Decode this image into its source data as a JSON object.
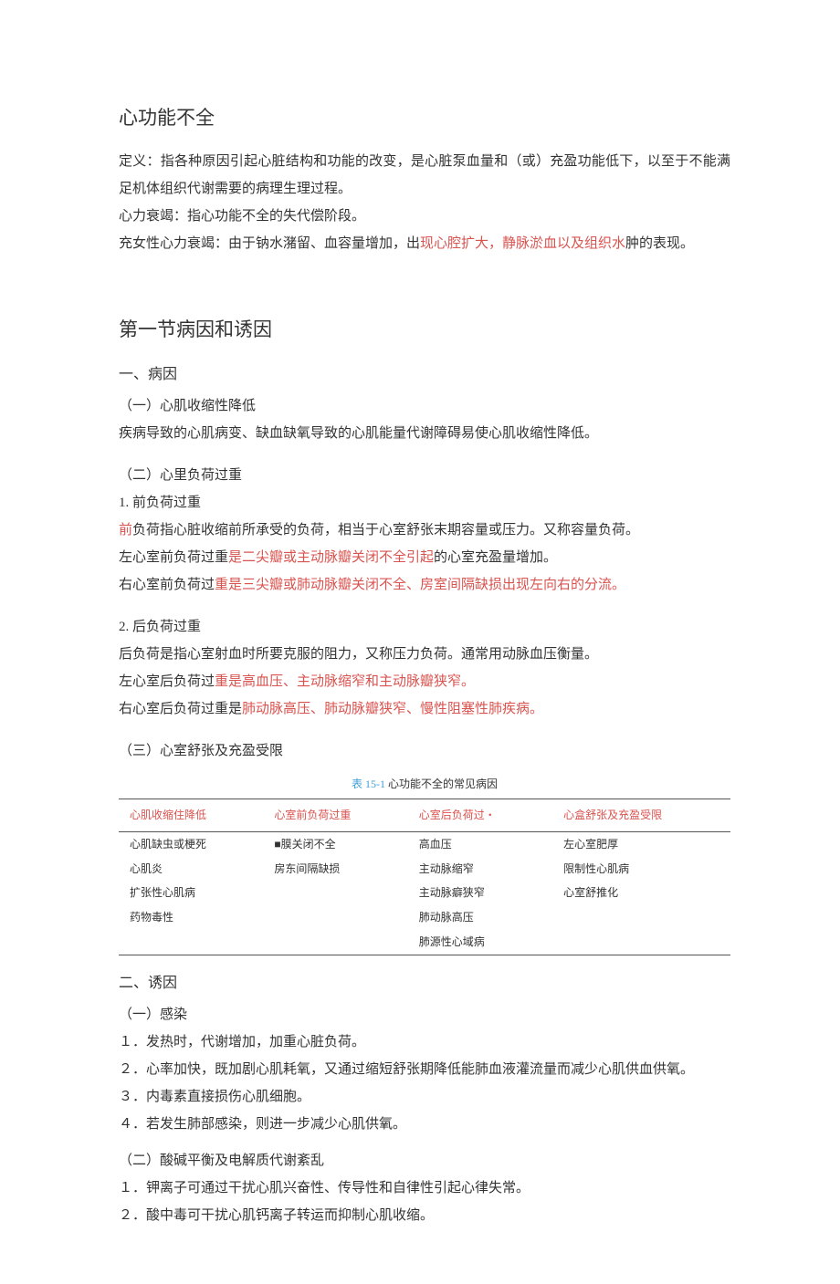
{
  "title": "心功能不全",
  "definition": {
    "label": "定义：",
    "body_a": "指各种原因引起心脏结构和功能的改变，是心脏泵血量和（或）充盈功能低下，以至于不能满足机体组织代谢需要的病理生理过程。"
  },
  "line_heart_failure": "心力衰竭：指心功能不全的失代偿阶段。",
  "congestive": {
    "pre": "充女性心力衰竭：由于钠水潴留、血容量增加，出",
    "red": "现心腔扩大，静脉淤血以及组织水",
    "post": "肿的表现。"
  },
  "sec1": {
    "heading": "第一节病因和诱因",
    "sub1": "一、病因",
    "item1_title": "（一）心肌收缩性降低",
    "item1_body": "疾病导致的心肌病变、缺血缺氧导致的心肌能量代谢障碍易使心肌收缩性降低。",
    "item2_title": "（二）心里负荷过重",
    "preload_label": "1. 前负荷过重",
    "preload_l1_pre": "前",
    "preload_l1_post": "负荷指心脏收缩前所承受的负荷，相当于心室舒张末期容量或压力。又称容量负荷。",
    "preload_l2_pre": "左心室前负荷过重",
    "preload_l2_red": "是二尖瓣或主动脉瓣关闭不全引起",
    "preload_l2_post": "的心室充盈量增加。",
    "preload_l3_pre": "右心室前负荷过",
    "preload_l3_red": "重是三尖瓣或肺动脉瓣关闭不全、房室间隔缺损出现左向右的分流。",
    "afterload_label": "2. 后负荷过重",
    "afterload_l1": "后负荷是指心室射血时所要克服的阻力，又称压力负荷。通常用动脉血压衡量。",
    "afterload_l2_pre": "左心室后负荷过",
    "afterload_l2_red": "重是高血压、主动脉缩窄和主动脉瓣狭窄。",
    "afterload_l3_pre": "右心室后负荷过重是",
    "afterload_l3_red": "肺动脉高压、肺动脉瓣狭窄、慢性阻塞性肺疾病。",
    "item3_title": "（三）心室舒张及充盈受限"
  },
  "table": {
    "caption_red": "表 15-1 ",
    "caption_plain": "心功能不全的常见病因",
    "headers": [
      "心肌收缩住降低",
      "心室前负荷过重",
      "心室后负荷过・",
      "心盒舒张及充盈受限"
    ],
    "rows": [
      [
        "心肌缺虫或梗死",
        "■膜关闭不全",
        "高血压",
        "左心室肥厚"
      ],
      [
        "心肌炎",
        "房东间隔缺损",
        "主动脉缩窄",
        "限制性心肌病"
      ],
      [
        "扩张性心肌病",
        "",
        "主动脉癖狭窄",
        "心室舒推化"
      ],
      [
        "药物毒性",
        "",
        "肺动脉高压",
        ""
      ],
      [
        "",
        "",
        "肺源性心域病",
        ""
      ]
    ]
  },
  "sec2": {
    "sub2": "二、诱因",
    "i1_title": "（一）感染",
    "i1_l1": "１．发热时，代谢增加，加重心脏负荷。",
    "i1_l2": "２．心率加快，既加剧心肌耗氧，又通过缩短舒张期降低能肺血液灌流量而减少心肌供血供氧。",
    "i1_l3": "３．内毒素直接损伤心肌细胞。",
    "i1_l4": "４．若发生肺部感染，则进一步减少心肌供氧。",
    "i2_title": "（二）酸碱平衡及电解质代谢紊乱",
    "i2_l1": "１．钾离子可通过干扰心肌兴奋性、传导性和自律性引起心律失常。",
    "i2_l2": "２．酸中毒可干扰心肌钙离子转运而抑制心肌收缩。"
  }
}
